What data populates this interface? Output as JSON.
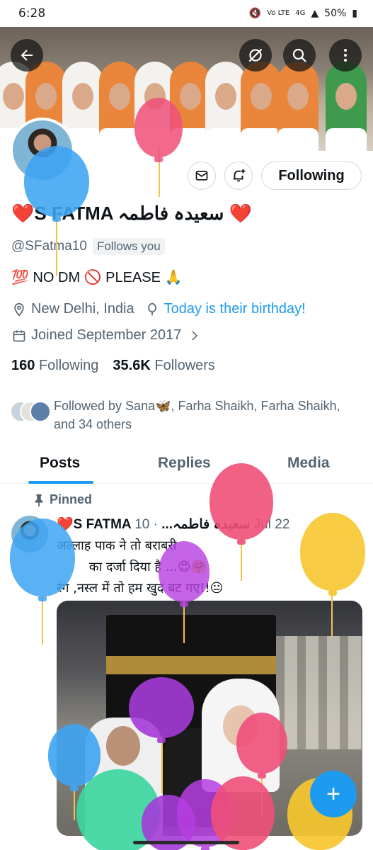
{
  "status_bar": {
    "time": "6:28",
    "network": "Vo LTE",
    "signal": "4G",
    "battery": "50%"
  },
  "header": {
    "back_icon": "arrow-left-icon",
    "hide_icon": "eye-slash-icon",
    "search_icon": "search-icon",
    "more_icon": "more-vertical-icon"
  },
  "profile": {
    "name": "❤️S FATMA سعیدہ فاطمہ ❤️",
    "handle": "@SFatma10",
    "follows_you": "Follows you",
    "bio": "💯 NO DM 🚫 PLEASE 🙏",
    "location": "New Delhi, India",
    "birthday": "Today is their birthday!",
    "joined": "Joined September 2017",
    "following_count": "160",
    "following_label": "Following",
    "followers_count": "35.6K",
    "followers_label": "Followers",
    "followed_by": "Followed by Sana🦋, Farha Shaikh, Farha Shaikh, and 34 others"
  },
  "actions": {
    "message_icon": "mail-icon",
    "notify_icon": "bell-plus-icon",
    "following_button": "Following"
  },
  "tabs": [
    {
      "label": "Posts",
      "active": true
    },
    {
      "label": "Replies",
      "active": false
    },
    {
      "label": "Media",
      "active": false
    }
  ],
  "post": {
    "pinned_label": "Pinned",
    "author": "❤️S FATMA سعیدہ فاطمہ...",
    "date": "· 10 Jul 22",
    "text": "अल्लाह पाक ने तो बराबरी\n        का दर्जा दिया है ...😍🤗\nरंग ,नस्ल में तो हम खुद बट गए!!😐"
  },
  "compose_label": "+",
  "colors": {
    "accent": "#1d9bf0",
    "text": "#0f1419",
    "muted": "#536471"
  }
}
